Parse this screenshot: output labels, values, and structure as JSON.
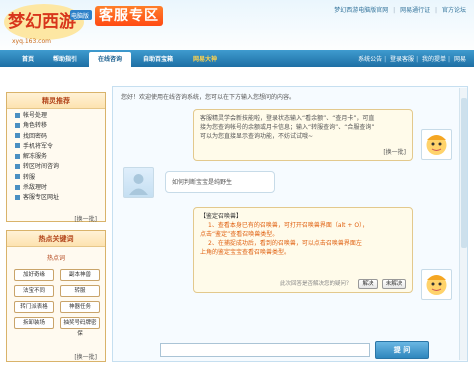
{
  "header": {
    "logo_text": "梦幻西游",
    "logo_badge": "电脑版",
    "logo_url": "xyq.163.com",
    "title": "客服专区",
    "links": [
      "梦幻西游电脑版官网",
      "网易通行证",
      "官方论坛"
    ]
  },
  "nav": {
    "tabs": [
      {
        "label": "首页"
      },
      {
        "label": "帮助指引"
      },
      {
        "label": "在线咨询"
      },
      {
        "label": "自助百宝箱"
      },
      {
        "label": "网易大神"
      }
    ],
    "right_links": [
      "系统公告",
      "登录客服",
      "我的提单",
      "网易"
    ]
  },
  "sidebar": {
    "recommend_title": "精灵推荐",
    "recommend_items": [
      "帐号处理",
      "角色转移",
      "找回密码",
      "手机将军令",
      "解冻服务",
      "转区时间咨询",
      "转服",
      "杀敌理时",
      "客服专区网址"
    ],
    "switch_label": "[换一批]",
    "hot_title": "热点关键词",
    "hot_subtitle": "热点词",
    "hot_chips": [
      "加好奇缘",
      "副本神兽",
      "法宝不同",
      "转服",
      "转门派表格",
      "神器任务",
      "拆卸装场",
      "抽奖号码牌密保"
    ],
    "hot_switch_label": "[换一批]"
  },
  "chat": {
    "greeting": "您好！欢迎使用在线咨询系统，您可以在下方输入您想问的内容。",
    "bot_msg_1": {
      "lines": [
        "客服精灵学会新技能啦，登录状态输入“看余额”、“查月卡”，可直",
        "接为您查询帐号的余额或月卡信息；输入“转服查询”、“合服查询”",
        "可以为您直接显示查询功能，不妨试试哦~"
      ],
      "switch_label": "[换一批]"
    },
    "user_msg": "如何判断宝宝是纯野生",
    "bot_msg_2": {
      "title": "【鉴定召唤兽】",
      "lines": [
        "1、查看本身已有的召唤兽，可打开召唤兽界面（alt + O），",
        "点击“鉴定”查看召唤兽类型。",
        "2、在捕捉成功后，看到的召唤兽，可以点击召唤兽界面左",
        "上角的鉴定宝宝查看召唤兽类型。"
      ],
      "feedback_question": "此次回答是否解决您的疑问？",
      "resolved_label": "解决",
      "unresolved_label": "未解决"
    },
    "input_value": "",
    "send_label": "提 问"
  }
}
